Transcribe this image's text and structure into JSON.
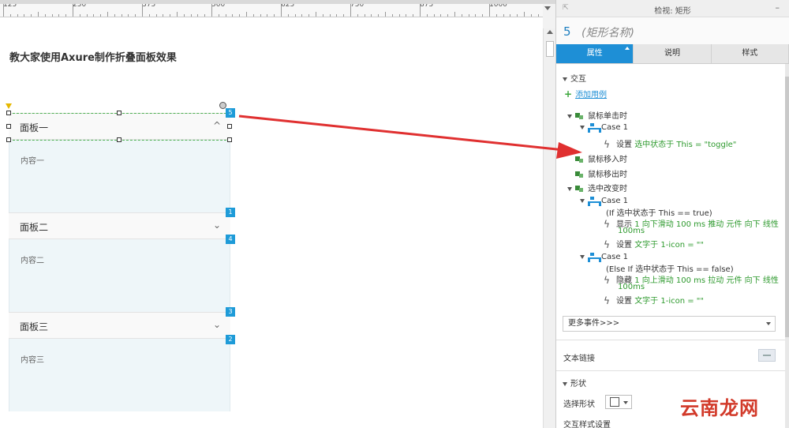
{
  "ruler": {
    "labels": [
      "125",
      "250",
      "375",
      "500",
      "625",
      "750",
      "875",
      "1000"
    ]
  },
  "canvas": {
    "page_title": "教大家使用Axure制作折叠面板效果",
    "panels": [
      {
        "title": "面板一",
        "content": "内容一",
        "chevron": "^",
        "chevron_icon": "chevron-up-icon"
      },
      {
        "title": "面板二",
        "content": "内容二",
        "chevron": "⌄",
        "chevron_icon": "chevron-down-icon"
      },
      {
        "title": "面板三",
        "content": "内容三",
        "chevron": "⌄",
        "chevron_icon": "chevron-down-icon"
      }
    ],
    "badges": [
      "5",
      "1",
      "4",
      "3",
      "2"
    ]
  },
  "inspector": {
    "title": "检视: 矩形",
    "widget_number": "5",
    "widget_name": "(矩形名称)",
    "tabs": [
      "属性",
      "说明",
      "样式"
    ],
    "active_tab": "属性",
    "interaction_section": "交互",
    "add_case": "添加用例",
    "events": {
      "on_click": "鼠标单击时",
      "click_case": "Case 1",
      "click_action_label": "设置",
      "click_action_detail": "选中状态于 This = \"toggle\"",
      "mouse_enter": "鼠标移入时",
      "mouse_leave": "鼠标移出时",
      "selected_change": "选中改变时",
      "case1_title": "Case 1",
      "case1_cond": "(If 选中状态于 This == true)",
      "case1_act1_label": "显示",
      "case1_act1_detail": "1 向下滑动 100 ms 推动 元件 向下 线性",
      "case1_act1_detail2": "100ms",
      "case1_act2_label": "设置",
      "case1_act2_detail": "文字于 1-icon = \"\"",
      "case2_title": "Case 1",
      "case2_cond": "(Else If 选中状态于 This == false)",
      "case2_act1_label": "隐藏",
      "case2_act1_detail": "1 向上滑动 100 ms 拉动 元件 向下 线性",
      "case2_act1_detail2": "100ms",
      "case2_act2_label": "设置",
      "case2_act2_detail": "文字于 1-icon = \"\""
    },
    "more_events": "更多事件>>>",
    "text_link": "文本链接",
    "shape_section": "形状",
    "select_shape": "选择形状",
    "interaction_style": "交互样式设置"
  },
  "watermark": "云南龙网",
  "colors": {
    "accent": "#1e8fd6",
    "green": "#2e9a2e",
    "arrow": "#e03030",
    "badge": "#1e9bd8"
  }
}
